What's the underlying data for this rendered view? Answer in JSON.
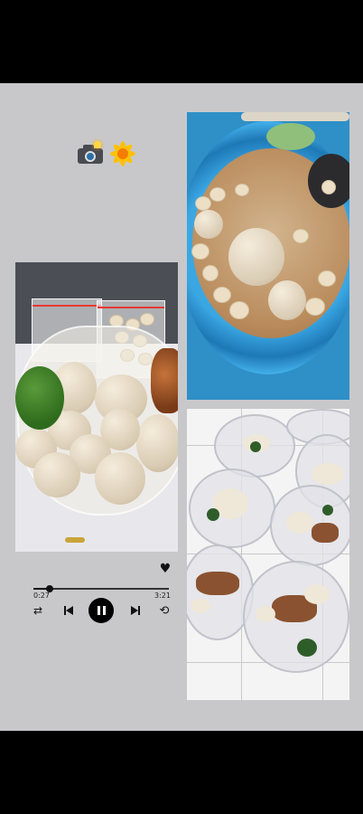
{
  "player": {
    "elapsed": "0:27",
    "duration": "3:21",
    "progress": 0.12
  },
  "icons": {
    "favorite": "heart-icon",
    "shuffle": "shuffle-icon",
    "previous": "previous-track-icon",
    "play_pause": "pause-icon",
    "next": "next-track-icon",
    "repeat": "repeat-icon",
    "stickers": [
      "camera-flash-icon",
      "sunflower-icon"
    ]
  },
  "colors": {
    "background": "#c8c8cb",
    "letterbox": "#000000",
    "control": "#111111"
  }
}
